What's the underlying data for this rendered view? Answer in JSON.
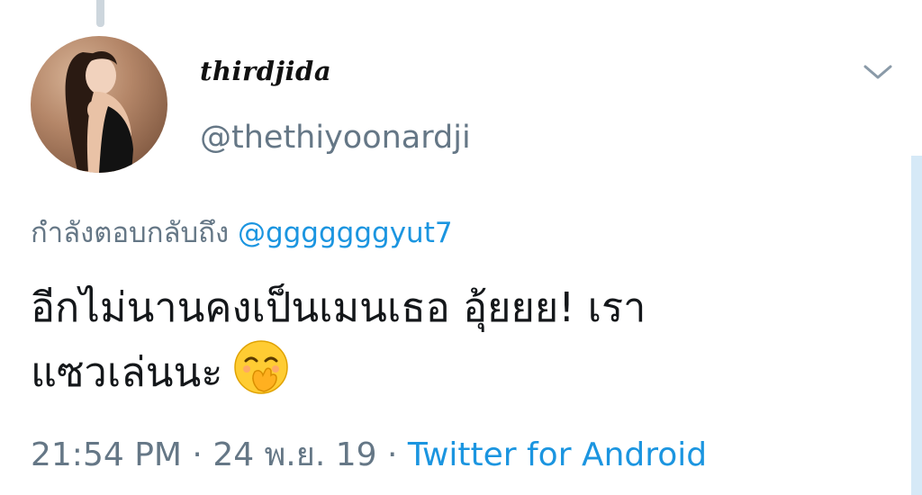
{
  "tweet": {
    "display_name": "thirdjida",
    "handle": "@thethiyoonardji",
    "reply_prefix": "กำลังตอบกลับถึง",
    "reply_to": "@gggggggyut7",
    "text_line1": "อีกไม่นานคงเป็นเมนเธอ อุ้ยยย! เรา",
    "text_line2": "แซวเล่นนะ",
    "emoji": "face-with-hand-over-mouth",
    "time": "21:54 PM",
    "date": "24 พ.ย. 19",
    "separator": "·",
    "source": "Twitter for Android"
  },
  "icons": {
    "more": "chevron-down-icon"
  },
  "colors": {
    "link": "#1b95e0",
    "secondary_text": "#657786",
    "primary_text": "#14171a"
  }
}
